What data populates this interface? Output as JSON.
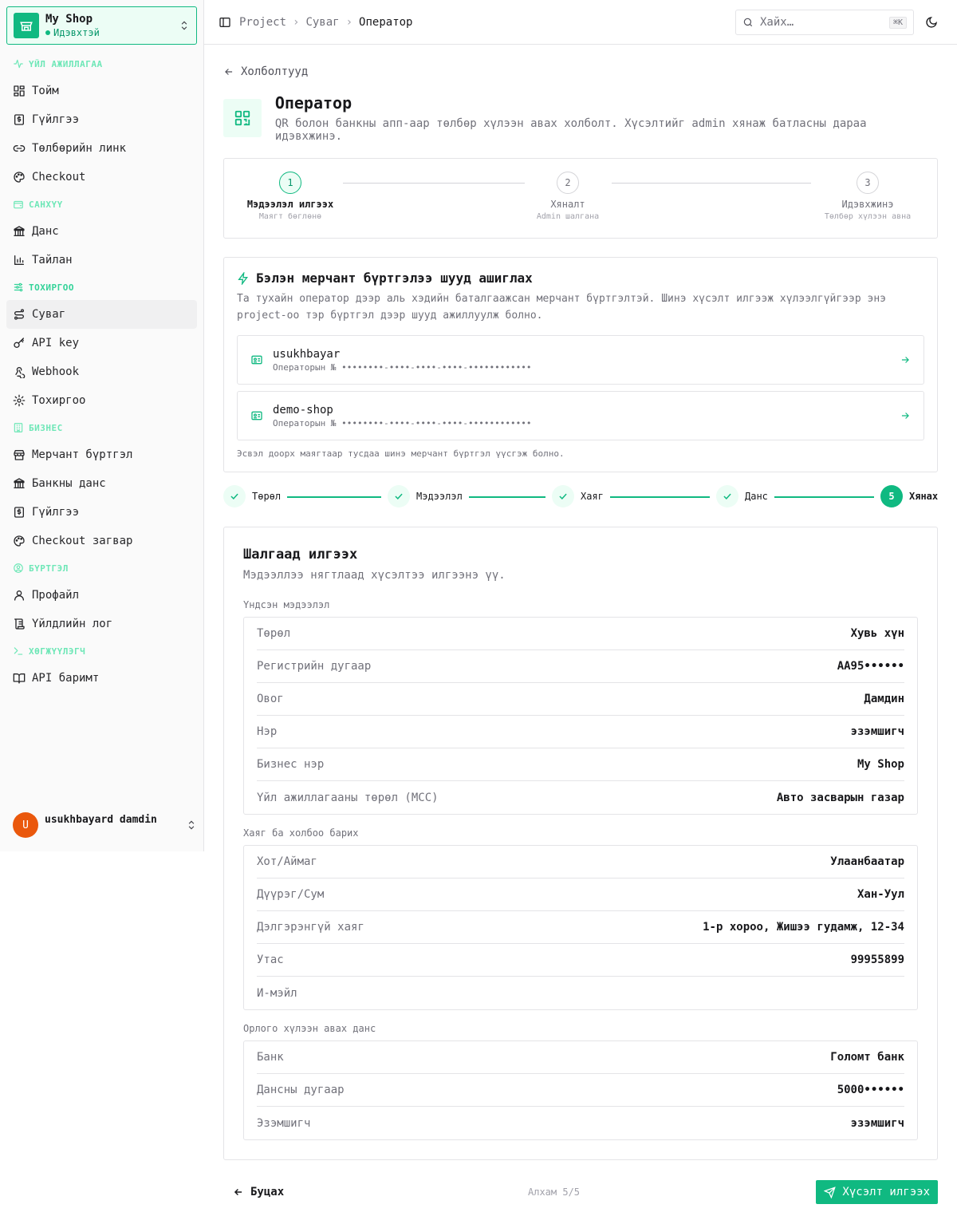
{
  "shop": {
    "name": "My Shop",
    "status": "Идэвхтэй"
  },
  "sidebar": {
    "sections": [
      {
        "label": "ҮЙЛ АЖИЛЛАГАА",
        "icon": "activity-icon",
        "items": [
          {
            "label": "Тойм",
            "icon": "dashboard-icon"
          },
          {
            "label": "Гүйлгээ",
            "icon": "receipt-icon"
          },
          {
            "label": "Төлбөрийн линк",
            "icon": "link-icon"
          },
          {
            "label": "Checkout",
            "icon": "palette-icon"
          }
        ]
      },
      {
        "label": "САНХҮҮ",
        "icon": "wallet-icon",
        "items": [
          {
            "label": "Данс",
            "icon": "bank-icon"
          },
          {
            "label": "Тайлан",
            "icon": "bar-chart-icon"
          }
        ]
      },
      {
        "label": "ТОХИРГОО",
        "icon": "sliders-icon",
        "items": [
          {
            "label": "Суваг",
            "icon": "route-icon",
            "active": true
          },
          {
            "label": "API key",
            "icon": "key-icon"
          },
          {
            "label": "Webhook",
            "icon": "webhook-icon"
          },
          {
            "label": "Тохиргоо",
            "icon": "gear-icon"
          }
        ]
      },
      {
        "label": "БИЗНЕС",
        "icon": "building-icon",
        "items": [
          {
            "label": "Мерчант бүртгэл",
            "icon": "store-icon"
          },
          {
            "label": "Банкны данс",
            "icon": "bank-icon"
          },
          {
            "label": "Гүйлгээ",
            "icon": "receipt-icon"
          },
          {
            "label": "Checkout загвар",
            "icon": "palette-icon"
          }
        ]
      },
      {
        "label": "БҮРТГЭЛ",
        "icon": "user-circle-icon",
        "items": [
          {
            "label": "Профайл",
            "icon": "user-icon"
          },
          {
            "label": "Үйлдлийн лог",
            "icon": "scroll-icon"
          }
        ]
      },
      {
        "label": "ХӨГЖҮҮЛЭГЧ",
        "icon": "terminal-icon",
        "items": [
          {
            "label": "API баримт",
            "icon": "book-icon"
          }
        ]
      }
    ],
    "user": {
      "initial": "U",
      "name": "usukhbayard damdin"
    }
  },
  "topbar": {
    "breadcrumb": [
      "Project",
      "Суваг",
      "Оператор"
    ],
    "search_placeholder": "Хайх…",
    "shortcut": "⌘K"
  },
  "page": {
    "back_label": "Холболтууд",
    "title": "Оператор",
    "description": "QR болон банкны апп-аар төлбөр хүлээн авах холболт. Хүсэлтийг admin хянаж батласны дараа идэвхжинэ.",
    "progress": [
      {
        "num": "1",
        "title": "Мэдээлэл илгээх",
        "sub": "Маягт бөглөнө",
        "active": true
      },
      {
        "num": "2",
        "title": "Хяналт",
        "sub": "Admin шалгана",
        "active": false
      },
      {
        "num": "3",
        "title": "Идэвхжинэ",
        "sub": "Төлбөр хүлээн авна",
        "active": false
      }
    ],
    "merchants": {
      "title": "Бэлэн мерчант бүртгэлээ шууд ашиглах",
      "description": "Та тухайн оператор дээр аль хэдийн баталгаажсан мерчант бүртгэлтэй. Шинэ хүсэлт илгээж хүлээлгүйгээр энэ project-оо тэр бүртгэл дээр шууд ажиллуулж болно.",
      "items": [
        {
          "name": "usukhbayar",
          "sub": "Операторын № ••••••••-••••-••••-••••-••••••••••••"
        },
        {
          "name": "demo-shop",
          "sub": "Операторын № ••••••••-••••-••••-••••-••••••••••••"
        }
      ],
      "footer": "Эсвэл доорх маягтаар тусдаа шинэ мерчант бүртгэл үүсгэж болно."
    },
    "wizard": [
      {
        "label": "Төрөл",
        "done": true
      },
      {
        "label": "Мэдээлэл",
        "done": true
      },
      {
        "label": "Хаяг",
        "done": true
      },
      {
        "label": "Данс",
        "done": true
      },
      {
        "label": "Хянах",
        "num": "5",
        "current": true
      }
    ],
    "review": {
      "title": "Шалгаад илгээх",
      "description": "Мэдээллээ нягтлаад хүсэлтээ илгээнэ үү.",
      "groups": [
        {
          "label": "Үндсэн мэдээлэл",
          "rows": [
            {
              "k": "Төрөл",
              "v": "Хувь хүн"
            },
            {
              "k": "Регистрийн дугаар",
              "v": "АА95••••••"
            },
            {
              "k": "Овог",
              "v": "Дамдин"
            },
            {
              "k": "Нэр",
              "v": "эзэмшигч"
            },
            {
              "k": "Бизнес нэр",
              "v": "My Shop"
            },
            {
              "k": "Үйл ажиллагааны төрөл (MCC)",
              "v": "Авто засварын газар"
            }
          ]
        },
        {
          "label": "Хаяг ба холбоо барих",
          "rows": [
            {
              "k": "Хот/Аймаг",
              "v": "Улаанбаатар"
            },
            {
              "k": "Дүүрэг/Сум",
              "v": "Хан-Уул"
            },
            {
              "k": "Дэлгэрэнгүй хаяг",
              "v": "1-р хороо, Жишээ гудамж, 12-34"
            },
            {
              "k": "Утас",
              "v": "99955899"
            },
            {
              "k": "И-мэйл",
              "v": ""
            }
          ]
        },
        {
          "label": "Орлого хүлээн авах данс",
          "rows": [
            {
              "k": "Банк",
              "v": "Голомт банк"
            },
            {
              "k": "Дансны дугаар",
              "v": "5000••••••"
            },
            {
              "k": "Эзэмшигч",
              "v": "эзэмшигч"
            }
          ]
        }
      ]
    },
    "footer": {
      "back": "Буцах",
      "step": "Алхам 5/5",
      "submit": "Хүсэлт илгээх"
    }
  },
  "colors": {
    "accent": "#10b981",
    "accent_light": "#ecfdf5",
    "avatar": "#ea580c"
  }
}
